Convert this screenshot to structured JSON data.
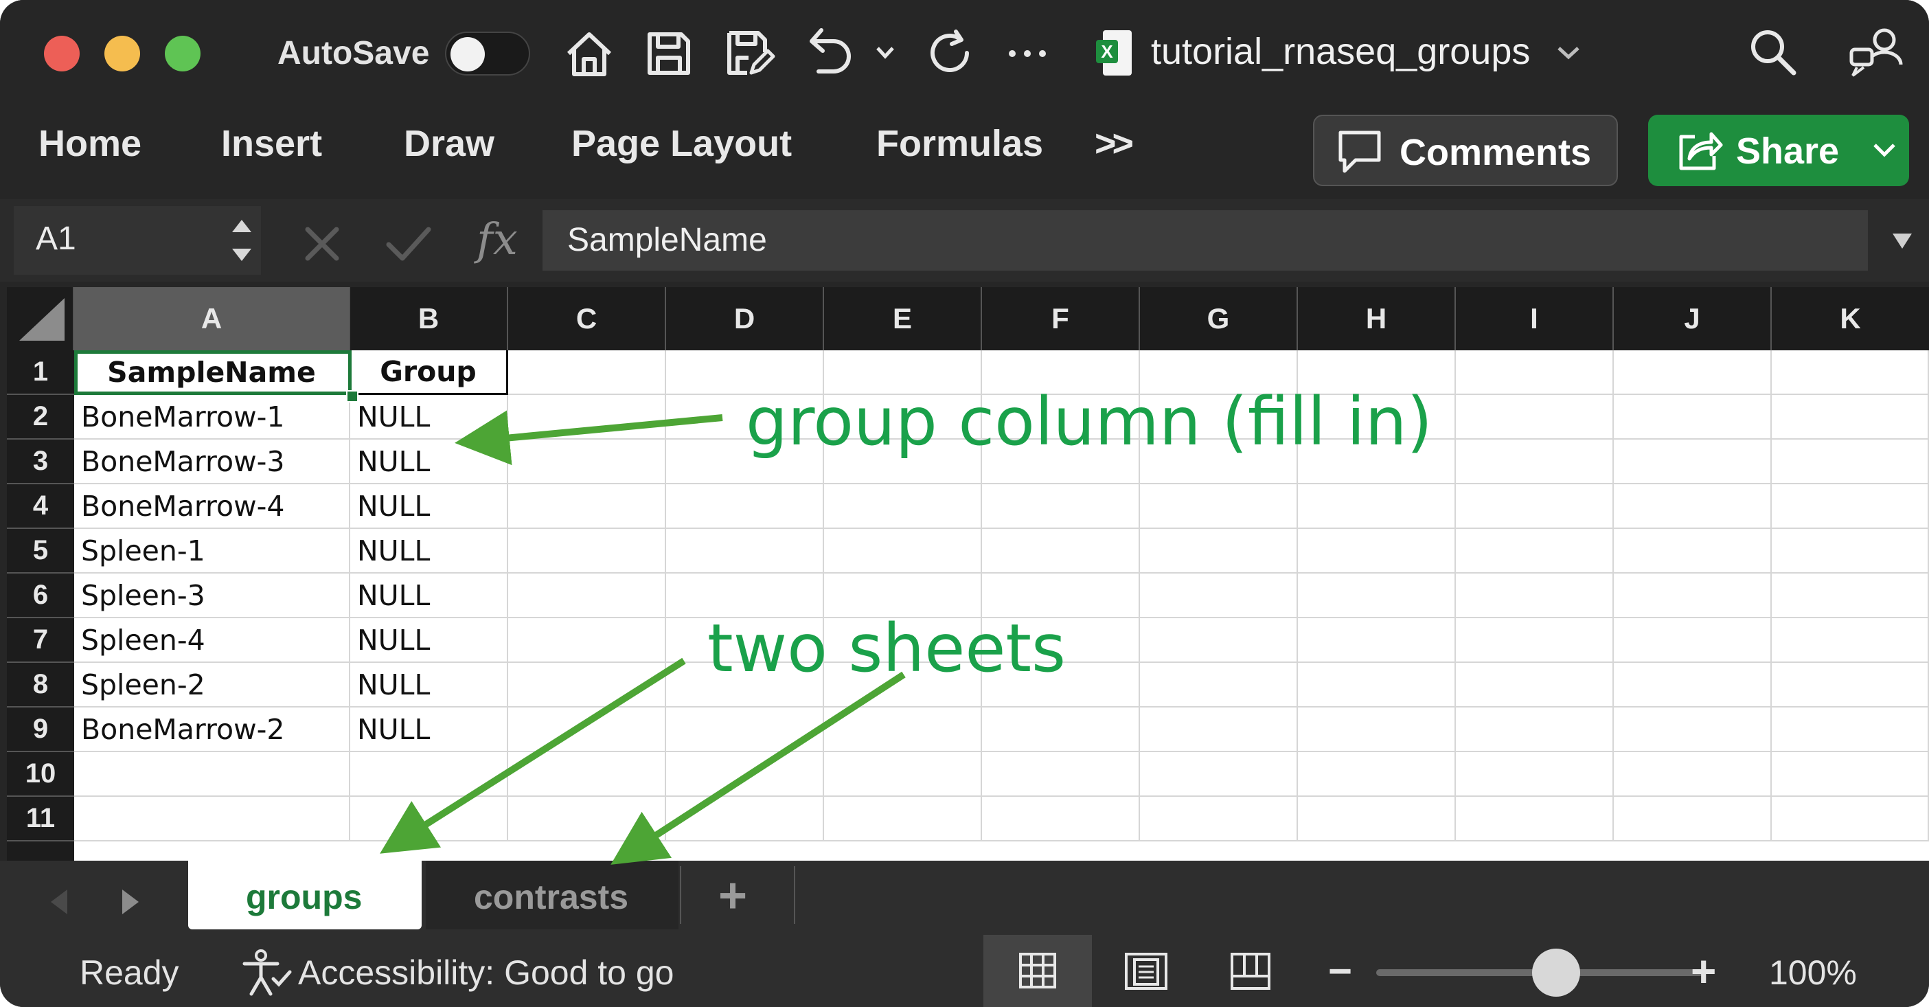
{
  "window": {
    "autosave_label": "AutoSave",
    "file_name": "tutorial_rnaseq_groups",
    "file_icon_letter": "X"
  },
  "ribbon": {
    "tabs": [
      "Home",
      "Insert",
      "Draw",
      "Page Layout",
      "Formulas"
    ],
    "more": ">>",
    "comments_label": "Comments",
    "share_label": "Share"
  },
  "formula_bar": {
    "name_box": "A1",
    "fx_label": "fx",
    "value": "SampleName"
  },
  "columns": [
    "A",
    "B",
    "C",
    "D",
    "E",
    "F",
    "G",
    "H",
    "I",
    "J",
    "K"
  ],
  "rows": [
    {
      "num": "1",
      "a": "SampleName",
      "b": "Group"
    },
    {
      "num": "2",
      "a": "BoneMarrow-1",
      "b": "NULL"
    },
    {
      "num": "3",
      "a": "BoneMarrow-3",
      "b": "NULL"
    },
    {
      "num": "4",
      "a": "BoneMarrow-4",
      "b": "NULL"
    },
    {
      "num": "5",
      "a": "Spleen-1",
      "b": "NULL"
    },
    {
      "num": "6",
      "a": "Spleen-3",
      "b": "NULL"
    },
    {
      "num": "7",
      "a": "Spleen-4",
      "b": "NULL"
    },
    {
      "num": "8",
      "a": "Spleen-2",
      "b": "NULL"
    },
    {
      "num": "9",
      "a": "BoneMarrow-2",
      "b": "NULL"
    },
    {
      "num": "10",
      "a": "",
      "b": ""
    },
    {
      "num": "11",
      "a": "",
      "b": ""
    }
  ],
  "sheets": {
    "tabs": [
      "groups",
      "contrasts"
    ],
    "active": "groups",
    "add_label": "+"
  },
  "status": {
    "ready": "Ready",
    "accessibility": "Accessibility: Good to go",
    "zoom_minus": "−",
    "zoom_plus": "+",
    "zoom": "100%",
    "zoom_level_fraction": 0.55
  },
  "annotations": {
    "group_column": "group column (fill in)",
    "two_sheets": "two sheets",
    "color": "#1aa14a",
    "arrow_color": "#4da535"
  },
  "colors": {
    "chrome": "#262626",
    "share_green": "#1e8e3e",
    "active_sheet": "#1d7a3a"
  }
}
